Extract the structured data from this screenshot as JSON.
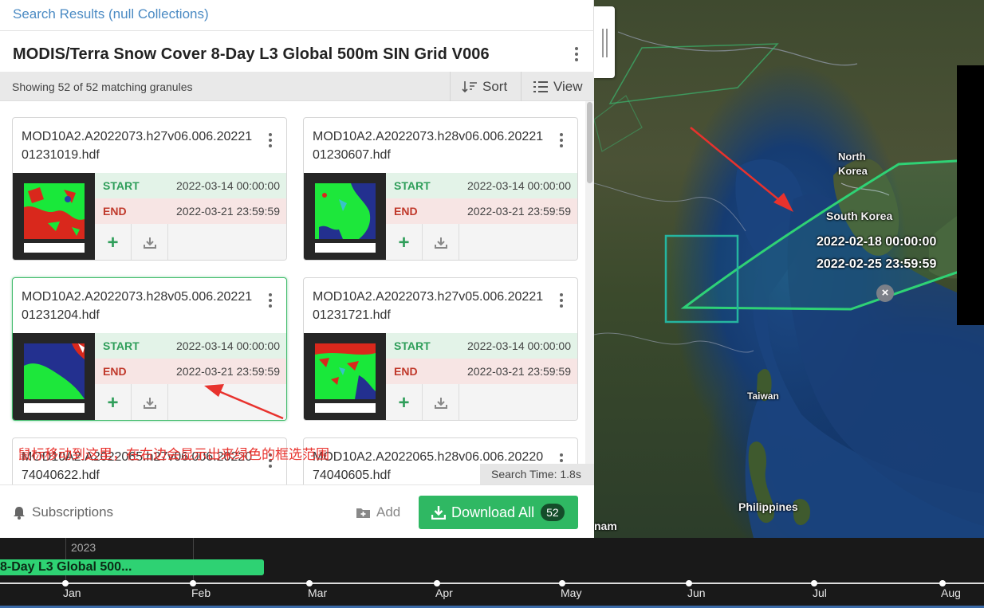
{
  "results_title": "Search Results (null Collections)",
  "collection_title": "MODIS/Terra Snow Cover 8-Day L3 Global 500m SIN Grid V006",
  "subbar": {
    "showing": "Showing 52 of 52 matching granules",
    "sort_label": "Sort",
    "view_label": "View"
  },
  "granules": [
    {
      "name": "MOD10A2.A2022073.h27v06.006.2022101231019.hdf",
      "start_label": "START",
      "start": "2022-03-14 00:00:00",
      "end_label": "END",
      "end": "2022-03-21 23:59:59",
      "add_label": "+"
    },
    {
      "name": "MOD10A2.A2022073.h28v06.006.2022101230607.hdf",
      "start_label": "START",
      "start": "2022-03-14 00:00:00",
      "end_label": "END",
      "end": "2022-03-21 23:59:59",
      "add_label": "+"
    },
    {
      "name": "MOD10A2.A2022073.h28v05.006.2022101231204.hdf",
      "start_label": "START",
      "start": "2022-03-14 00:00:00",
      "end_label": "END",
      "end": "2022-03-21 23:59:59",
      "add_label": "+"
    },
    {
      "name": "MOD10A2.A2022073.h27v05.006.2022101231721.hdf",
      "start_label": "START",
      "start": "2022-03-14 00:00:00",
      "end_label": "END",
      "end": "2022-03-21 23:59:59",
      "add_label": "+"
    },
    {
      "name": "MOD10A2.A2022065.h27v06.006.2022074040622.hdf"
    },
    {
      "name": "MOD10A2.A2022065.h28v06.006.2022074040605.hdf"
    }
  ],
  "search_time": "Search Time: 1.8s",
  "annotation_text": "鼠标移动到这里，在右边会显示出来绿色的框选范围",
  "footer": {
    "subscriptions_label": "Subscriptions",
    "add_label": "Add",
    "download_label": "Download All",
    "download_count": "52"
  },
  "map": {
    "labels": {
      "north_korea_1": "North",
      "north_korea_2": "Korea",
      "south_korea": "South Korea",
      "taiwan": "Taiwan",
      "philippines": "Philippines",
      "vietnam_partial": "nam"
    },
    "granule_start": "2022-02-18 00:00:00",
    "granule_end": "2022-02-25 23:59:59",
    "close_symbol": "×"
  },
  "timeline": {
    "year": "2023",
    "bar_label": "8-Day L3 Global 500...",
    "months": [
      "Jan",
      "Feb",
      "Mar",
      "Apr",
      "May",
      "Jun",
      "Jul",
      "Aug"
    ]
  },
  "colors": {
    "accent_green": "#2fb863",
    "link_blue": "#4a8ac3",
    "start_green": "#2f9e5a",
    "end_red": "#c0392b",
    "annotation_red": "#e8322d"
  }
}
